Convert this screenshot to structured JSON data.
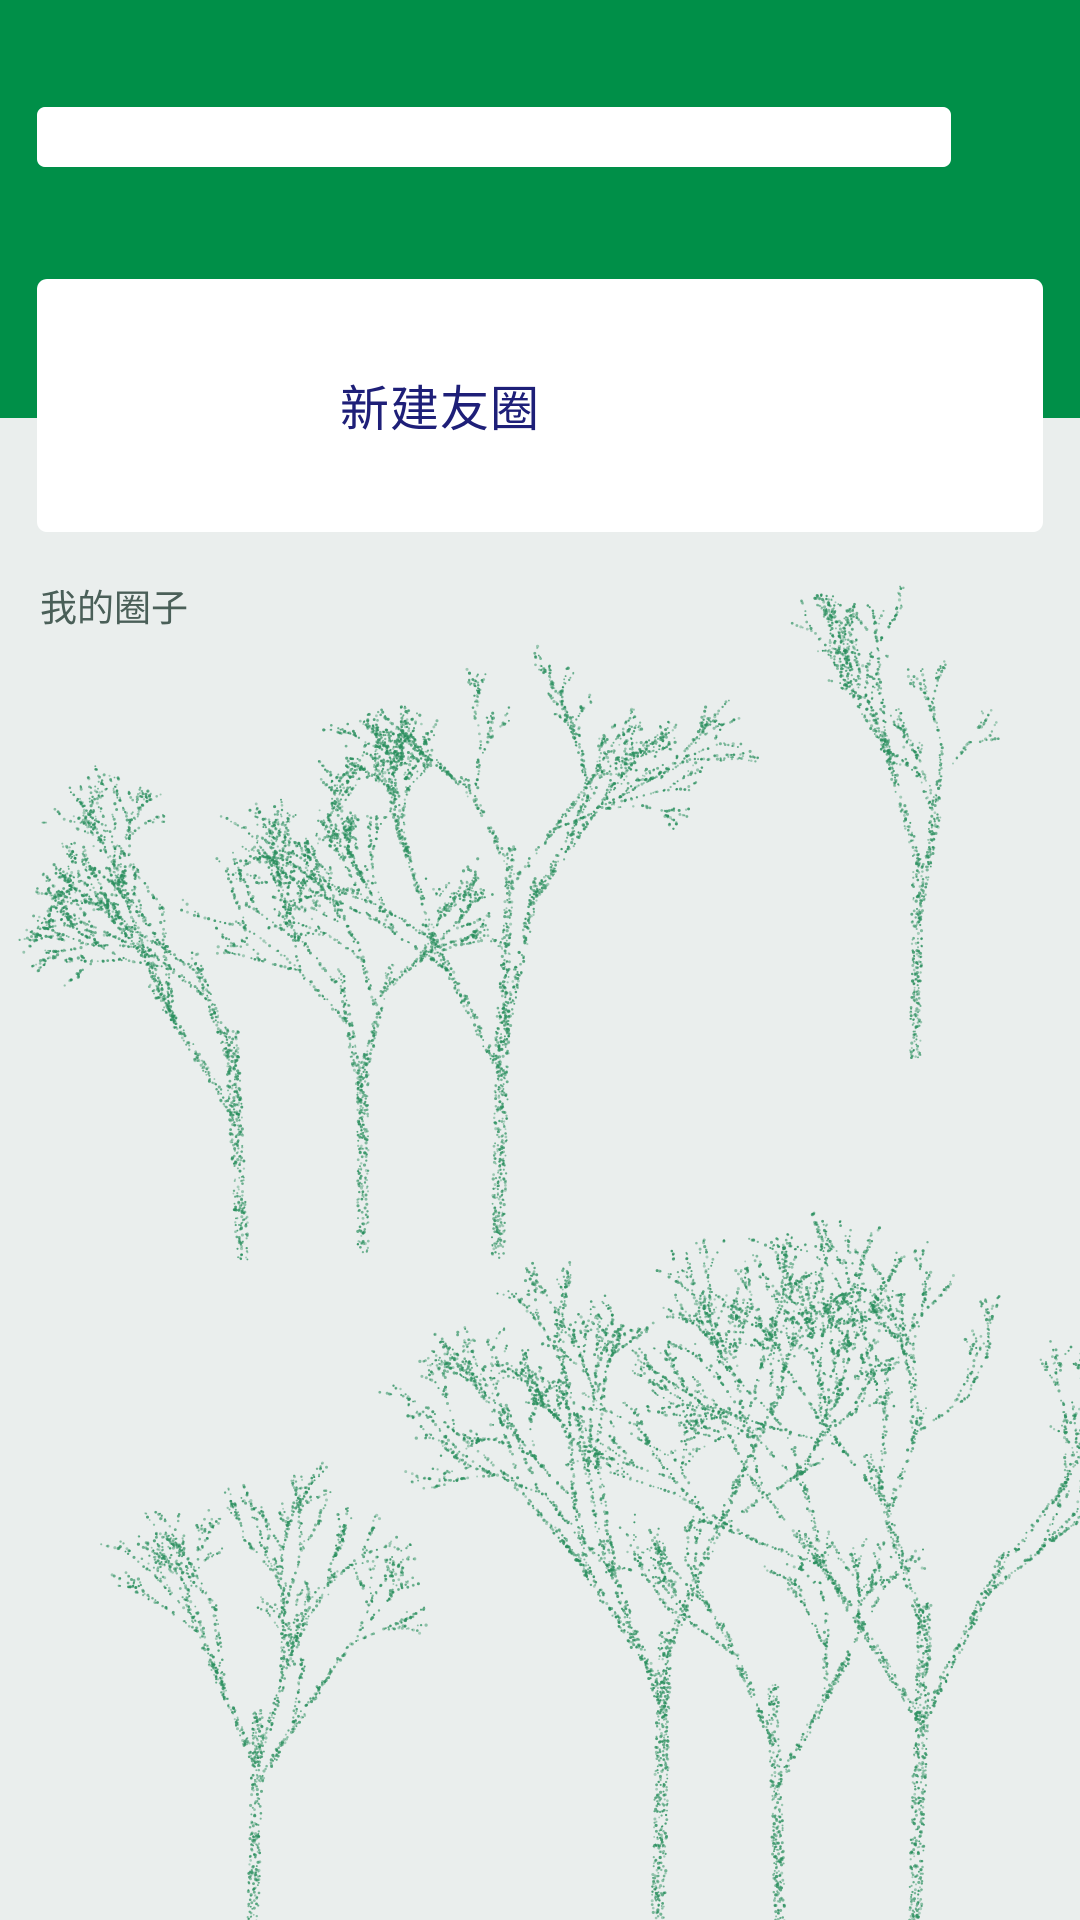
{
  "colors": {
    "header_green": "#008f48",
    "page_background": "#eaeeed",
    "new_circle_text": "#1e1f78",
    "section_title_text": "#4a5f58",
    "tree_dots": "#2a8f5e"
  },
  "search": {
    "value": "",
    "placeholder": ""
  },
  "new_circle": {
    "label": "新建友圈"
  },
  "my_circles": {
    "title": "我的圈子"
  },
  "background": {
    "icon": "tree-forest-illustration"
  }
}
